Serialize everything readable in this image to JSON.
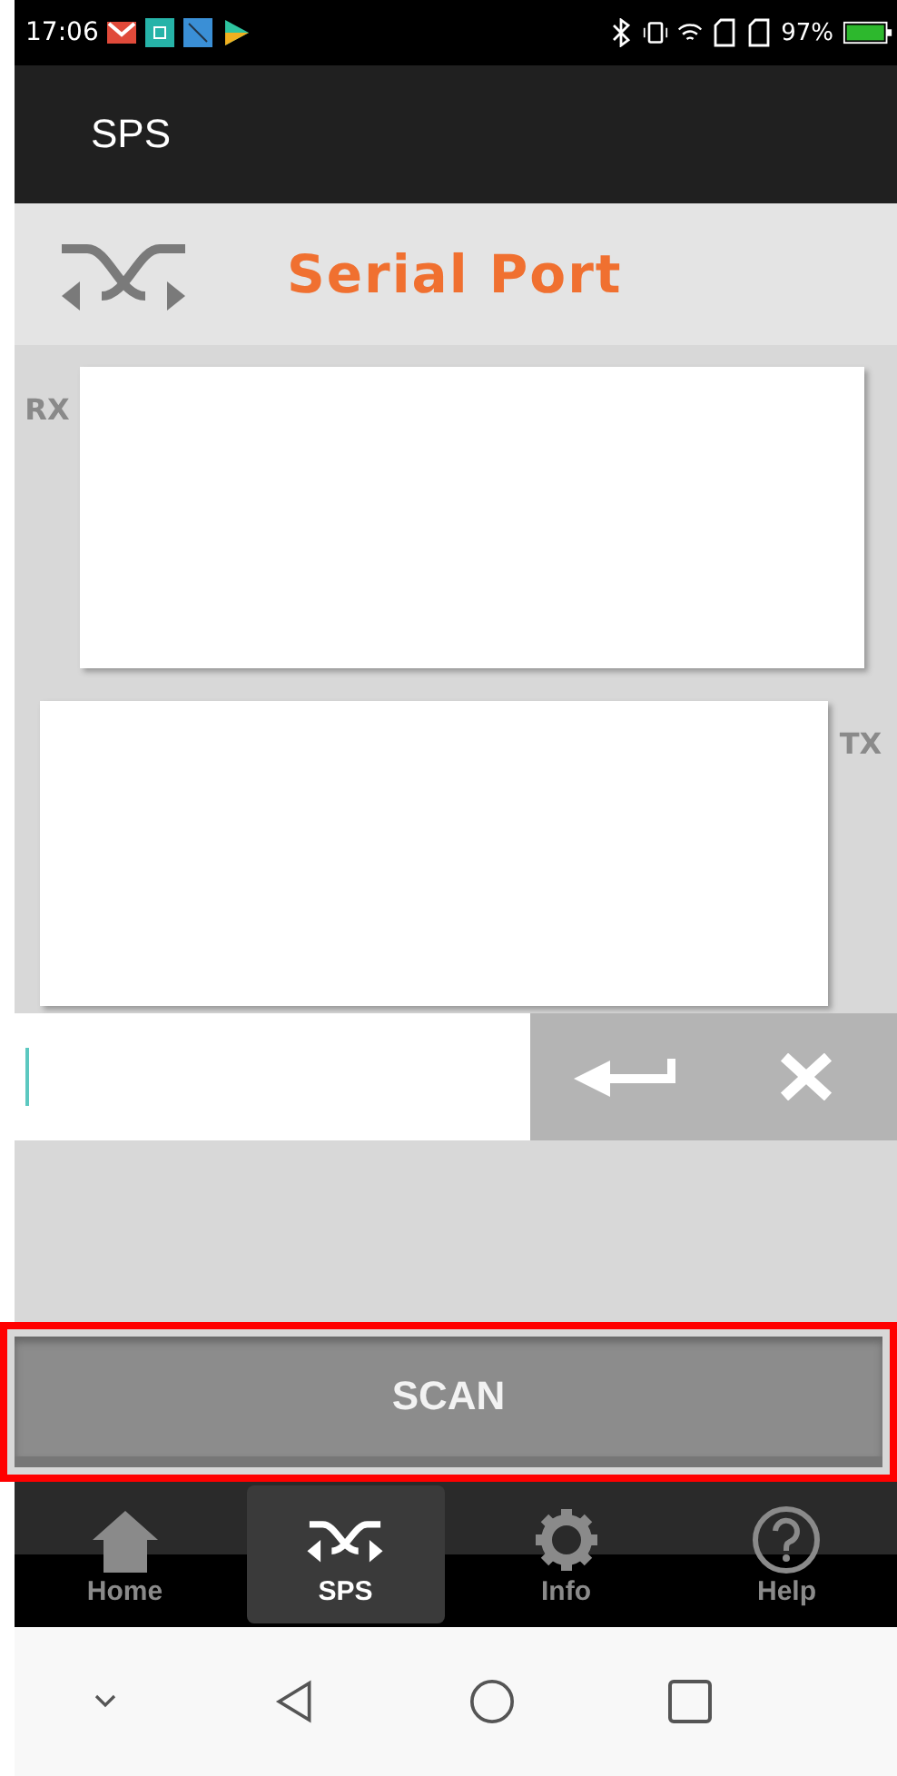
{
  "status_bar": {
    "time": "17:06",
    "battery_text": "97%"
  },
  "app_bar": {
    "title": "SPS"
  },
  "header": {
    "title": "Serial Port"
  },
  "rx": {
    "label": "RX"
  },
  "tx": {
    "label": "TX"
  },
  "scan_button": {
    "label": "SCAN",
    "highlighted": true
  },
  "tabs": [
    {
      "label": "Home",
      "selected": false
    },
    {
      "label": "SPS",
      "selected": true
    },
    {
      "label": "Info",
      "selected": false
    },
    {
      "label": "Help",
      "selected": false
    }
  ]
}
